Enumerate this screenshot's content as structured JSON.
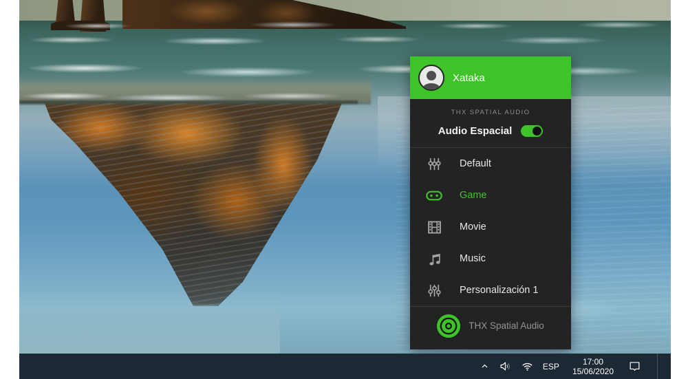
{
  "desktop": {
    "wallpaper": "ocean-sea-stacks-with-orange-cliff-reflection-photo"
  },
  "panel": {
    "accent_color": "#3ec329",
    "header": {
      "username": "Xataka",
      "avatar_icon": "user-avatar-icon"
    },
    "section_title": "THX SPATIAL AUDIO",
    "spatial_toggle": {
      "label": "Audio Espacial",
      "enabled": true
    },
    "modes": [
      {
        "label": "Default",
        "icon": "equalizer-icon",
        "active": false
      },
      {
        "label": "Game",
        "icon": "gamepad-icon",
        "active": true
      },
      {
        "label": "Movie",
        "icon": "film-strip-icon",
        "active": false
      },
      {
        "label": "Music",
        "icon": "music-note-icon",
        "active": false
      },
      {
        "label": "Personalización 1",
        "icon": "vertical-sliders-icon",
        "active": false
      }
    ],
    "footer": {
      "app_name": "THX Spatial Audio",
      "icon": "thx-spatial-audio-logo-icon"
    }
  },
  "taskbar": {
    "background_color": "#1c2834",
    "tray_icons": [
      "chevron-up-icon",
      "speaker-icon",
      "wifi-icon"
    ],
    "language": "ESP",
    "clock": {
      "time": "17:00",
      "date": "15/06/2020"
    },
    "action_center_icon": "action-center-icon"
  }
}
